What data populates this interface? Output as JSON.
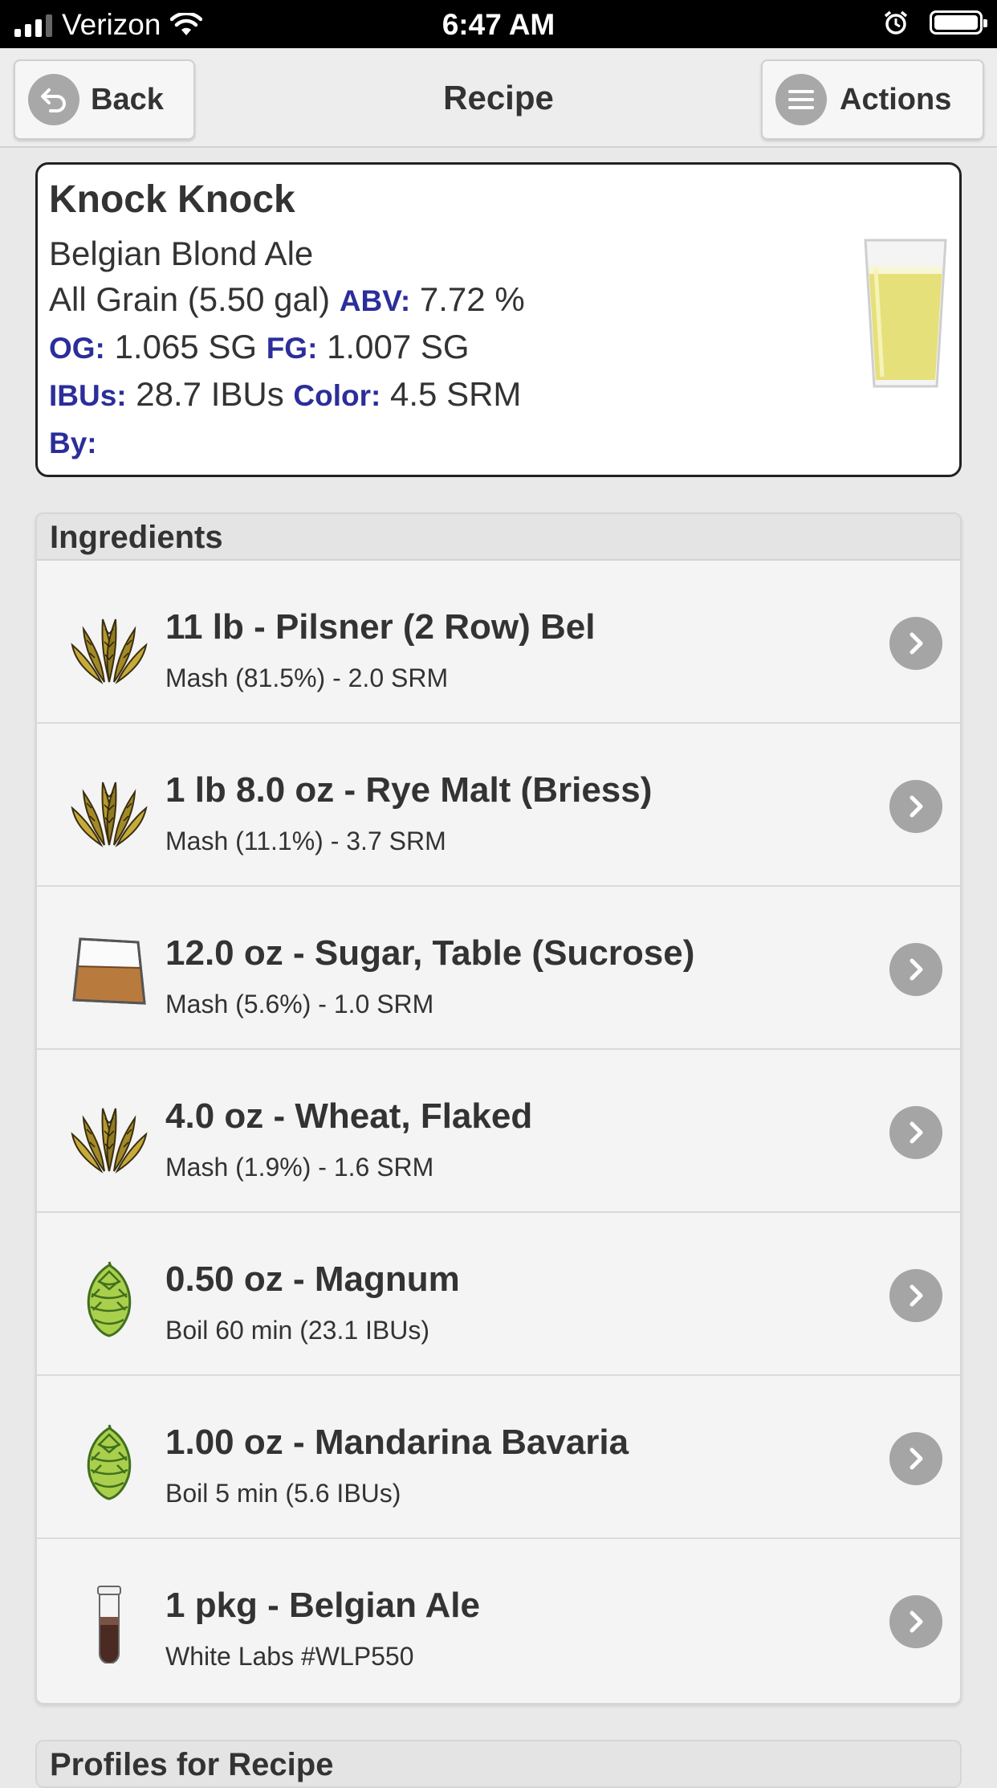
{
  "status_bar": {
    "carrier": "Verizon",
    "time": "6:47 AM"
  },
  "header": {
    "back_label": "Back",
    "title": "Recipe",
    "actions_label": "Actions"
  },
  "recipe": {
    "name": "Knock Knock",
    "style": "Belgian Blond Ale",
    "type_batch": "All Grain (5.50 gal)",
    "abv_label": "ABV:",
    "abv": "7.72 %",
    "og_label": "OG:",
    "og": "1.065 SG",
    "fg_label": "FG:",
    "fg": "1.007 SG",
    "ibu_label": "IBUs:",
    "ibu": "28.7 IBUs",
    "color_label": "Color:",
    "color": "4.5 SRM",
    "by_label": "By:",
    "beer_color": "#e6e07a"
  },
  "ingredients": {
    "title": "Ingredients",
    "items": [
      {
        "icon": "grain-icon",
        "title": "11 lb - Pilsner (2 Row) Bel",
        "subtitle": "Mash (81.5%) - 2.0 SRM"
      },
      {
        "icon": "grain-icon",
        "title": "1 lb 8.0 oz - Rye Malt (Briess)",
        "subtitle": "Mash (11.1%) - 3.7 SRM"
      },
      {
        "icon": "sugar-bag-icon",
        "title": "12.0 oz - Sugar, Table (Sucrose)",
        "subtitle": "Mash (5.6%) - 1.0 SRM"
      },
      {
        "icon": "grain-icon",
        "title": "4.0 oz - Wheat, Flaked",
        "subtitle": "Mash (1.9%) - 1.6 SRM"
      },
      {
        "icon": "hop-icon",
        "title": "0.50 oz - Magnum",
        "subtitle": "Boil 60 min (23.1 IBUs)"
      },
      {
        "icon": "hop-icon",
        "title": "1.00 oz - Mandarina Bavaria",
        "subtitle": "Boil 5 min (5.6 IBUs)"
      },
      {
        "icon": "yeast-vial-icon",
        "title": "1 pkg - Belgian Ale",
        "subtitle": "White Labs #WLP550"
      }
    ]
  },
  "profiles": {
    "title": "Profiles for Recipe"
  },
  "colors": {
    "label_blue": "#2b2e9a",
    "chevron_gray": "#a5a5a5"
  }
}
